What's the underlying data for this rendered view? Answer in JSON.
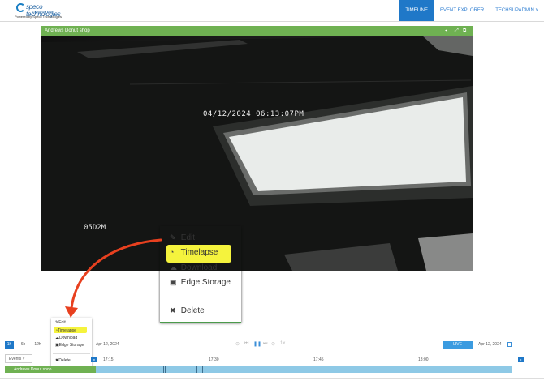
{
  "header": {
    "logo": {
      "brand": "speco technologies",
      "tagline": "Giving You More",
      "powered_by": "Powered by Speco Technologies"
    },
    "nav": [
      {
        "label": "TIMELINE"
      },
      {
        "label": "EVENT EXPLORER"
      },
      {
        "label": "TECHSUPADMIN ˅"
      }
    ]
  },
  "video": {
    "camera_name": "Andrews Donut shop",
    "timestamp": "04/12/2024  06:13:07PM",
    "overlay_id": "05D2M"
  },
  "context_menu": {
    "items": [
      {
        "label": "Edit",
        "icon": "pencil-icon",
        "glyph": "✎"
      },
      {
        "label": "Timelapse",
        "icon": "timelapse-icon",
        "glyph": "◔"
      },
      {
        "label": "Download",
        "icon": "cloud-download-icon",
        "glyph": "☁"
      },
      {
        "label": "Edge Storage",
        "icon": "save-icon",
        "glyph": "▣"
      },
      {
        "label": "Delete",
        "icon": "close-icon",
        "glyph": "✖"
      }
    ]
  },
  "timeline": {
    "ranges": [
      "1h",
      "6h",
      "12h"
    ],
    "left_date": "Apr 12, 2024",
    "right_date": "Apr 12, 2024",
    "live_label": "LIVE",
    "speed_label": "1x",
    "events_label": "Events ˅",
    "times": [
      "17:15",
      "17:30",
      "17:45",
      "18:00"
    ],
    "track_label": "Andrews Donut shop"
  },
  "colors": {
    "accent": "#1f78c8",
    "camera_bar": "#6fb152",
    "highlight": "#f5f33d",
    "arrow": "#e8401f"
  }
}
